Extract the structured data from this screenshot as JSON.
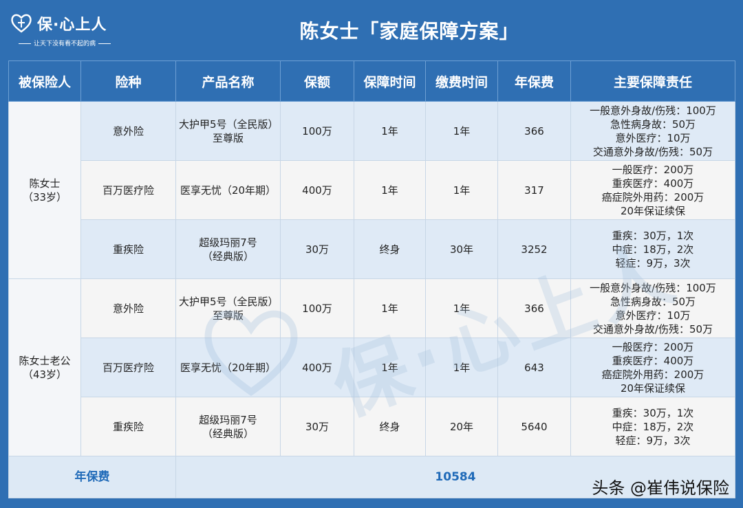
{
  "logo": {
    "name": "保·心上人",
    "slogan": "让天下没有看不起的病"
  },
  "title": "陈女士「家庭保障方案」",
  "columns": [
    "被保险人",
    "险种",
    "产品名称",
    "保额",
    "保障时间",
    "缴费时间",
    "年保费",
    "主要保障责任"
  ],
  "insured": [
    {
      "name": "陈女士",
      "age": "（33岁）"
    },
    {
      "name": "陈女士老公",
      "age": "（43岁）"
    }
  ],
  "rows": [
    {
      "type": "意外险",
      "product": [
        "大护甲5号（全民版）",
        "至尊版"
      ],
      "amount": "100万",
      "term": "1年",
      "pay": "1年",
      "premium": "366",
      "duty": [
        "一般意外身故/伤残：100万",
        "急性病身故：50万",
        "意外医疗：10万",
        "交通意外身故/伤残：50万"
      ]
    },
    {
      "type": "百万医疗险",
      "product": [
        "医享无忧（20年期）"
      ],
      "amount": "400万",
      "term": "1年",
      "pay": "1年",
      "premium": "317",
      "duty": [
        "一般医疗：200万",
        "重疾医疗：400万",
        "癌症院外用药：200万",
        "20年保证续保"
      ]
    },
    {
      "type": "重疾险",
      "product": [
        "超级玛丽7号",
        "（经典版）"
      ],
      "amount": "30万",
      "term": "终身",
      "pay": "30年",
      "premium": "3252",
      "duty": [
        "重疾：30万，1次",
        "中症：18万，2次",
        "轻症：9万，3次"
      ]
    },
    {
      "type": "意外险",
      "product": [
        "大护甲5号（全民版）",
        "至尊版"
      ],
      "amount": "100万",
      "term": "1年",
      "pay": "1年",
      "premium": "366",
      "duty": [
        "一般意外身故/伤残：100万",
        "急性病身故：50万",
        "意外医疗：10万",
        "交通意外身故/伤残：50万"
      ]
    },
    {
      "type": "百万医疗险",
      "product": [
        "医享无忧（20年期）"
      ],
      "amount": "400万",
      "term": "1年",
      "pay": "1年",
      "premium": "643",
      "duty": [
        "一般医疗：200万",
        "重疾医疗：400万",
        "癌症院外用药：200万",
        "20年保证续保"
      ]
    },
    {
      "type": "重疾险",
      "product": [
        "超级玛丽7号",
        "（经典版）"
      ],
      "amount": "30万",
      "term": "终身",
      "pay": "20年",
      "premium": "5640",
      "duty": [
        "重疾：30万，1次",
        "中症：18万，2次",
        "轻症：9万，3次"
      ]
    }
  ],
  "total": {
    "label": "年保费",
    "value": "10584"
  },
  "watermark": "保·心上人",
  "credit": "头条 @崔伟说保险",
  "colors": {
    "background": "#2f6fb3",
    "header_text": "#ffffff",
    "row_blue": "#dfeaf6",
    "row_white": "#f5f5f5",
    "total_text": "#1f6ab8"
  }
}
